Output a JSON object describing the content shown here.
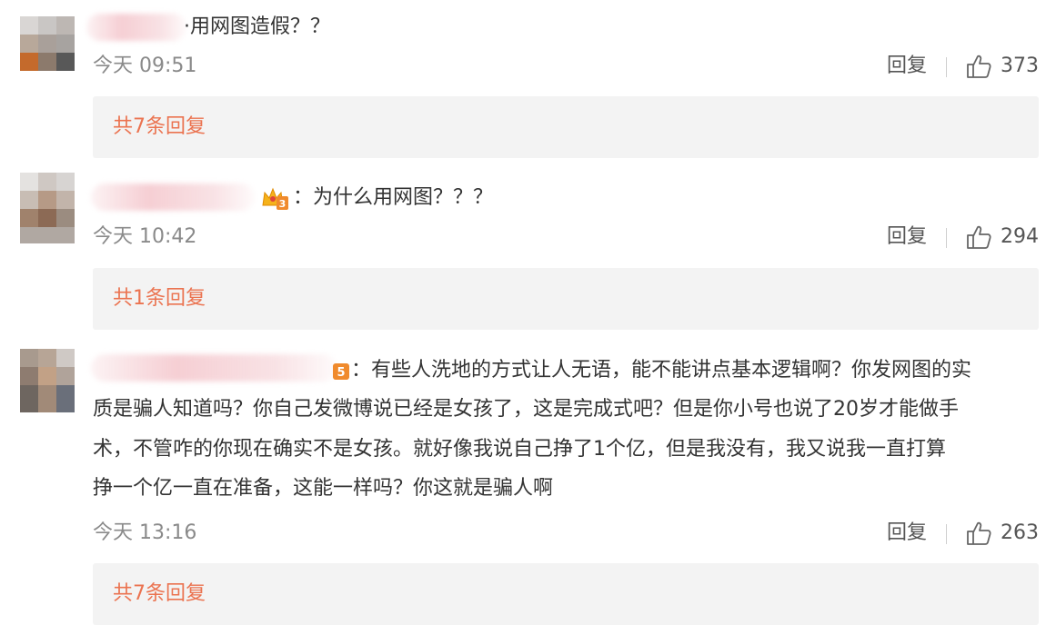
{
  "comments": [
    {
      "text": "·用网图造假？？",
      "time": "今天 09:51",
      "reply_label": "回复",
      "likes": "373",
      "replies_label": "共7条回复"
    },
    {
      "text": "：为什么用网图？？？",
      "time": "今天 10:42",
      "reply_label": "回复",
      "likes": "294",
      "replies_label": "共1条回复",
      "badge_text": "3"
    },
    {
      "text_lines": [
        "：有些人洗地的方式让人无语，能不能讲点基本逻辑啊？你发网图的实",
        "质是骗人知道吗？你自己发微博说已经是女孩了，这是完成式吧？但是你小号也说了20岁才能做手",
        "术，不管咋的你现在确实不是女孩。就好像我说自己挣了1个亿，但是我没有，我又说我一直打算",
        "挣一个亿一直在准备，这能一样吗？你这就是骗人啊"
      ],
      "time": "今天 13:16",
      "reply_label": "回复",
      "likes": "263",
      "replies_label": "共7条回复",
      "badge_text": "5"
    }
  ],
  "icons": {
    "like": "thumbs-up-icon",
    "crown": "crown-badge-icon",
    "level": "level-badge-icon"
  },
  "colors": {
    "accent": "#eb7350",
    "muted": "#8a8a8a",
    "reply_bg": "#f3f3f3"
  }
}
